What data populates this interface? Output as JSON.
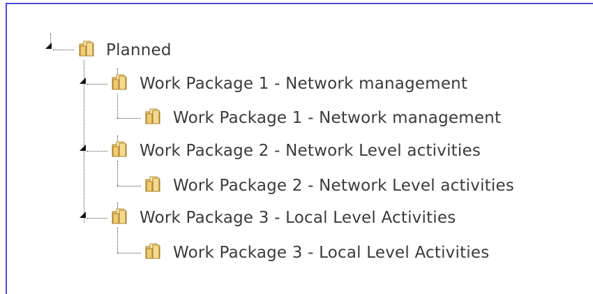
{
  "tree": {
    "root": {
      "label": "Planned",
      "icon": "folder-icon",
      "expanded": true
    },
    "packages": [
      {
        "label": "Work Package 1 - Network management",
        "child_label": "Work Package 1 - Network management"
      },
      {
        "label": "Work Package 2 - Network Level activities",
        "child_label": "Work Package 2 - Network Level activities"
      },
      {
        "label": "Work Package 3 - Local Level Activities",
        "child_label": "Work Package 3 - Local Level Activities"
      }
    ]
  },
  "colors": {
    "frame_border": "#4a4ad8",
    "text": "#3b3b3b",
    "folder_fill": "#f2d58a",
    "folder_edge": "#b8923a"
  }
}
